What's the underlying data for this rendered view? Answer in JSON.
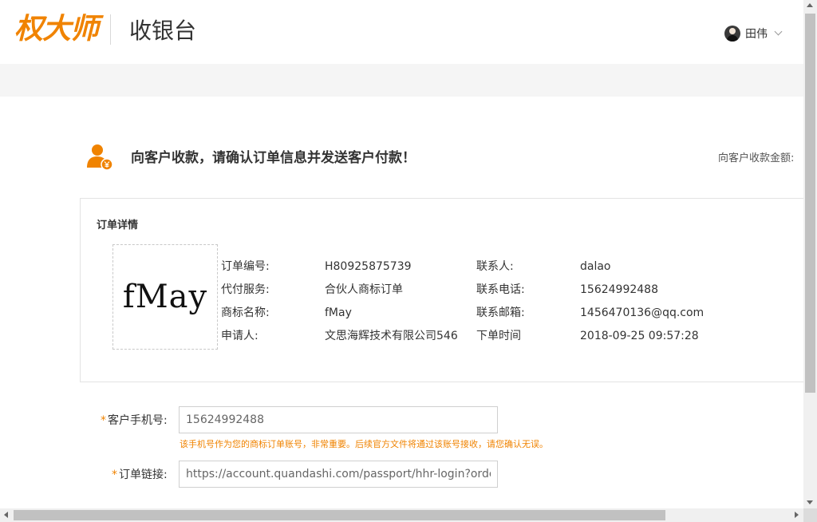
{
  "header": {
    "logo_text": "权大师",
    "page_title": "收银台",
    "user_name": "田伟"
  },
  "notice": {
    "title": "向客户收款，请确认订单信息并发送客户付款！",
    "amount_label": "向客户收款金额:"
  },
  "order": {
    "section_title": "订单详情",
    "trademark_image_text": "fMay",
    "left_fields": [
      {
        "label": "订单编号:",
        "value": "H80925875739"
      },
      {
        "label": "代付服务:",
        "value": "合伙人商标订单"
      },
      {
        "label": "商标名称:",
        "value": "fMay"
      },
      {
        "label": "申请人:",
        "value": "文思海辉技术有限公司546"
      }
    ],
    "right_fields": [
      {
        "label": "联系人:",
        "value": "dalao"
      },
      {
        "label": "联系电话:",
        "value": "15624992488"
      },
      {
        "label": "联系邮箱:",
        "value": "1456470136@qq.com"
      },
      {
        "label": "下单时间",
        "value": "2018-09-25 09:57:28"
      }
    ]
  },
  "form": {
    "required_mark": "*",
    "phone_label": "客户手机号:",
    "phone_value": "15624992488",
    "phone_hint": "该手机号作为您的商标订单账号，非常重要。后续官方文件将通过该账号接收，请您确认无误。",
    "link_label": "订单链接:",
    "link_value": "https://account.quandashi.com/passport/hhr-login?order"
  },
  "colors": {
    "brand": "#f08300",
    "hint": "#f08300"
  },
  "icons": {
    "user": "user-avatar-icon",
    "menu": "chevron-down-icon",
    "notice": "customer-payment-icon"
  }
}
